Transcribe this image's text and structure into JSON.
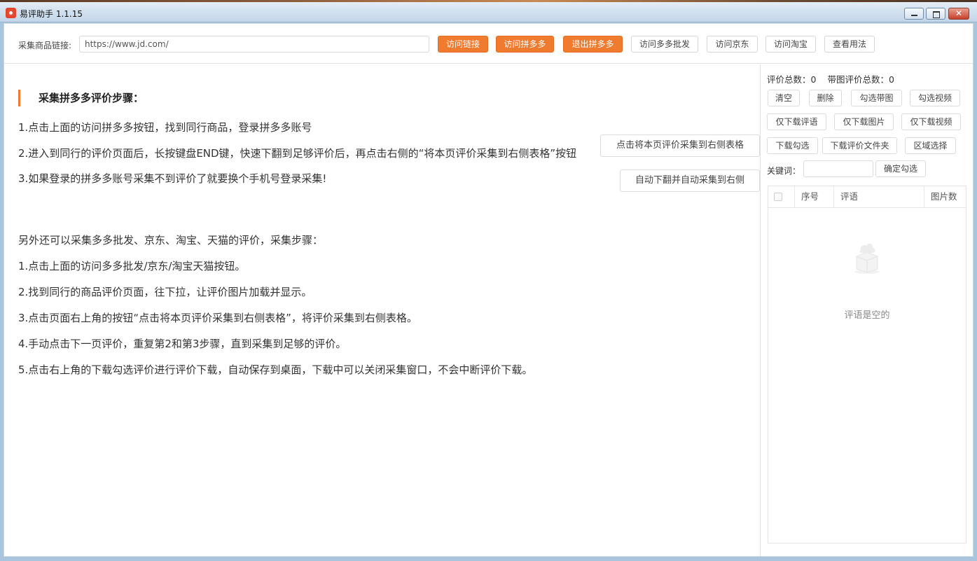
{
  "window": {
    "title": "易评助手 1.1.15",
    "close_glyph": "✕"
  },
  "toolbar": {
    "url_label": "采集商品链接:",
    "url_value": "https://www.jd.com/",
    "buttons": {
      "visit_link": "访问链接",
      "visit_pdd": "访问拼多多",
      "exit_pdd": "退出拼多多",
      "visit_pdd_wholesale": "访问多多批发",
      "visit_jd": "访问京东",
      "visit_taobao": "访问淘宝",
      "view_usage": "查看用法"
    }
  },
  "instructions": {
    "heading": "采集拼多多评价步骤：",
    "pdd_steps": [
      "1.点击上面的访问拼多多按钮，找到同行商品，登录拼多多账号",
      "2.进入到同行的评价页面后，长按键盘END键，快速下翻到足够评价后，再点击右侧的“将本页评价采集到右侧表格”按钮",
      "3.如果登录的拼多多账号采集不到评价了就要换个手机号登录采集!"
    ],
    "other_intro": "另外还可以采集多多批发、京东、淘宝、天猫的评价，采集步骤：",
    "other_steps": [
      "1.点击上面的访问多多批发/京东/淘宝天猫按钮。",
      "2.找到同行的商品评价页面，往下拉，让评价图片加载并显示。",
      "3.点击页面右上角的按钮“点击将本页评价采集到右侧表格”，将评价采集到右侧表格。",
      "4.手动点击下一页评价，重复第2和第3步骤，直到采集到足够的评价。",
      "5.点击右上角的下载勾选评价进行评价下载，自动保存到桌面，下载中可以关闭采集窗口，不会中断评价下载。"
    ],
    "collect_page_button": "点击将本页评价采集到右侧表格",
    "auto_scroll_button": "自动下翻并自动采集到右侧"
  },
  "panel": {
    "total_reviews": "评价总数：0",
    "total_with_images": "带图评价总数：0",
    "buttons": {
      "clear": "清空",
      "delete": "删除",
      "select_with_images": "勾选带图",
      "select_videos": "勾选视频",
      "download_text_only": "仅下载评语",
      "download_images_only": "仅下载图片",
      "download_videos_only": "仅下载视频",
      "download_selected": "下载勾选",
      "download_review_folder": "下载评价文件夹",
      "region_select": "区域选择",
      "confirm_select": "确定勾选"
    },
    "keyword_label": "关键词：",
    "keyword_value": "",
    "table": {
      "columns": [
        "序号",
        "评语",
        "图片数"
      ],
      "empty_text": "评语是空的"
    }
  },
  "colors": {
    "accent_orange": "#f07a2d",
    "title_bar": "#d5e3f0"
  }
}
